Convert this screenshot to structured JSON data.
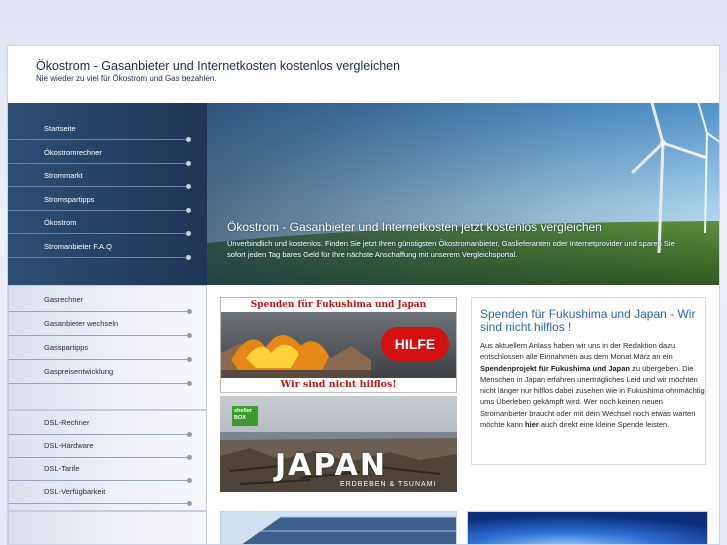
{
  "header": {
    "title": "Ökostrom - Gasanbieter und Internetkosten kostenlos vergleichen",
    "tagline": "Nie wieder zu viel für Ökostrom und Gas bezahlen."
  },
  "nav_main": [
    {
      "label": "Startseite"
    },
    {
      "label": "Ökostromrechner"
    },
    {
      "label": "Strommarkt"
    },
    {
      "label": "Stromspartipps"
    },
    {
      "label": "Ökostrom"
    },
    {
      "label": "Stromanbieter F.A.Q"
    }
  ],
  "hero": {
    "title": "Ökostrom - Gasanbieter und Internetkosten jetzt kostenlos vergleichen",
    "text": "Unverbindlich und kostenlos. Finden Sie jetzt Ihren günstigsten Ökostromanbieter, Gaslieferanten oder Internetprovider und sparen Sie sofort jeden Tag bares Geld für Ihre nächste Anschaffung mit unserem Vergleichsportal."
  },
  "nav_gas": [
    {
      "label": "Gasrechner"
    },
    {
      "label": "Gasanbieter wechseln"
    },
    {
      "label": "Gasspartipps"
    },
    {
      "label": "Gaspreisentwicklung"
    }
  ],
  "nav_dsl": [
    {
      "label": "DSL-Rechner"
    },
    {
      "label": "DSL-Hardware"
    },
    {
      "label": "DSL-Tarife"
    },
    {
      "label": "DSL-Verfügbarkeit"
    }
  ],
  "fukushima_banner": {
    "top_text": "Spenden für Fukushima und Japan",
    "button": "HILFE",
    "bottom_text": "Wir sind nicht hilflos!"
  },
  "japan_banner": {
    "logo": "shelter BOX",
    "word": "JAPAN",
    "subtitle": "ERDBEBEN & TSUNAMI"
  },
  "article": {
    "title": "Spenden für Fukushima und Japan - Wir sind nicht hilflos !",
    "p1": "Aus aktuellem Anlass haben wir uns in der Redaktion dazu entschlossen alle Einnahmen aus dem Monat März an ein ",
    "bold": "Spendenprojekt für Fukushima und Japan",
    "p2": " zu übergeben. Die Menschen in Japan erfahren unerträgliches Leid und wir möchten nicht länger nur hilflos dabei zusehen wie in Fukushima ohnmächtig ums Überleben gekämpft wird. Wer noch keinen neuen Stromanbieter braucht oder mit dem Wechsel noch etwas warten möchte kann ",
    "link": "hier",
    "p3": " auch direkt eine kleine Spende leisten."
  },
  "colors": {
    "nav_bg": "#243f62",
    "title_blue": "#2a65b5",
    "alert_red": "#d40f0f"
  }
}
